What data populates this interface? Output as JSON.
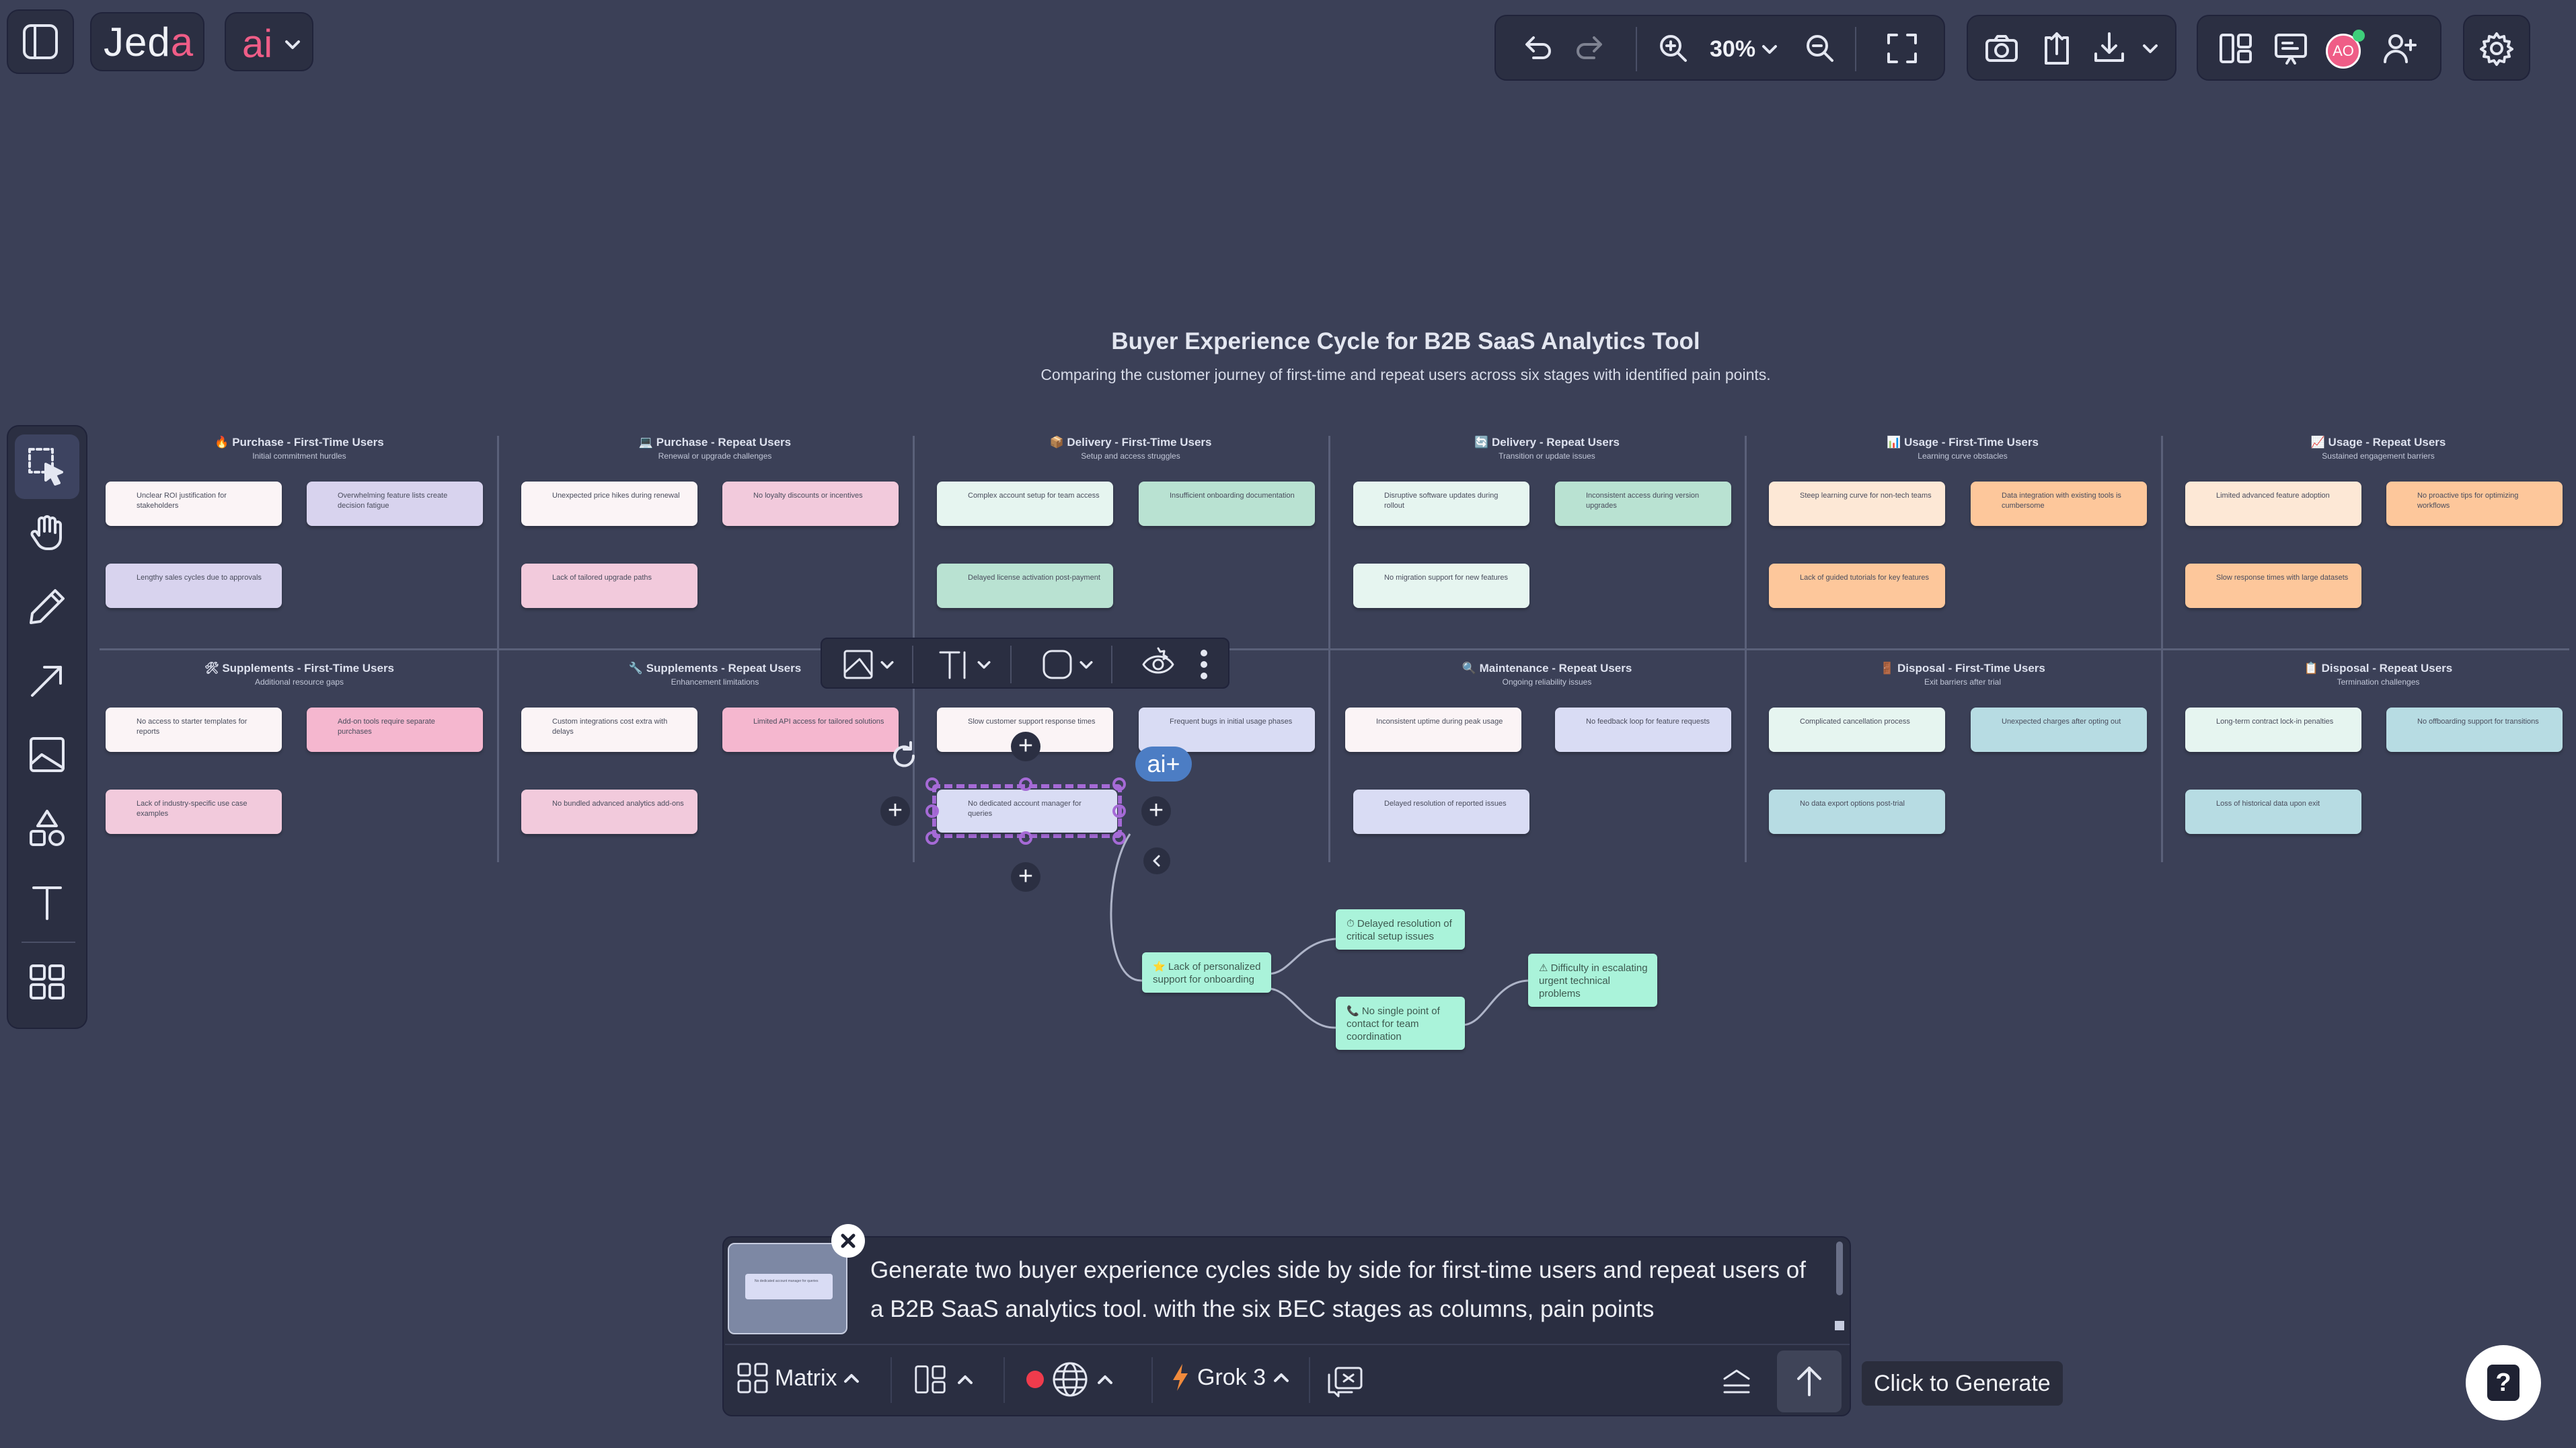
{
  "app": {
    "logo_text": "Jed",
    "logo_accent": "a",
    "ai_label": "ai",
    "accent_color": "#ef5d87"
  },
  "toolbar": {
    "zoom_value": "30%",
    "avatar_initials": "AO",
    "icons": [
      "undo-icon",
      "redo-icon",
      "zoom-in-icon",
      "zoom-out-icon",
      "fullscreen-icon",
      "camera-icon",
      "upload-icon",
      "download-icon",
      "layout-icon",
      "presentation-icon",
      "add-user-icon",
      "settings-icon"
    ]
  },
  "tools": [
    "select-tool-icon",
    "hand-tool-icon",
    "pencil-tool-icon",
    "arrow-tool-icon",
    "image-tool-icon",
    "shapes-tool-icon",
    "text-tool-icon",
    "templates-tool-icon"
  ],
  "canvas": {
    "title": "Buyer Experience Cycle for B2B SaaS Analytics Tool",
    "subtitle": "Comparing the customer journey of first-time and repeat users across six stages with identified pain points.",
    "columns_top": [
      {
        "emoji": "🔥",
        "title": "Purchase - First-Time Users",
        "sub": "Initial commitment hurdles"
      },
      {
        "emoji": "💻",
        "title": "Purchase - Repeat Users",
        "sub": "Renewal or upgrade challenges"
      },
      {
        "emoji": "📦",
        "title": "Delivery - First-Time Users",
        "sub": "Setup and access struggles"
      },
      {
        "emoji": "🔄",
        "title": "Delivery - Repeat Users",
        "sub": "Transition or update issues"
      },
      {
        "emoji": "📊",
        "title": "Usage - First-Time Users",
        "sub": "Learning curve obstacles"
      },
      {
        "emoji": "📈",
        "title": "Usage - Repeat Users",
        "sub": "Sustained engagement barriers"
      }
    ],
    "columns_bottom": [
      {
        "emoji": "🛠",
        "title": "Supplements - First-Time Users",
        "sub": "Additional resource gaps"
      },
      {
        "emoji": "🔧",
        "title": "Supplements - Repeat Users",
        "sub": "Enhancement limitations"
      },
      {
        "emoji": "",
        "title": "",
        "sub": ""
      },
      {
        "emoji": "🔍",
        "title": "Maintenance - Repeat Users",
        "sub": "Ongoing reliability issues"
      },
      {
        "emoji": "🚪",
        "title": "Disposal - First-Time Users",
        "sub": "Exit barriers after trial"
      },
      {
        "emoji": "📋",
        "title": "Disposal - Repeat Users",
        "sub": "Termination challenges"
      }
    ],
    "notes": {
      "r1": [
        [
          "Unclear ROI justification for stakeholders",
          "Overwhelming feature lists create decision fatigue",
          "Lengthy sales cycles due to approvals"
        ],
        [
          "Unexpected price hikes during renewal",
          "No loyalty discounts or incentives",
          "Lack of tailored upgrade paths"
        ],
        [
          "Complex account setup for team access",
          "Insufficient onboarding documentation",
          "Delayed license activation post-payment"
        ],
        [
          "Disruptive software updates during rollout",
          "Inconsistent access during version upgrades",
          "No migration support for new features"
        ],
        [
          "Steep learning curve for non-tech teams",
          "Data integration with existing tools is cumbersome",
          "Lack of guided tutorials for key features"
        ],
        [
          "Limited advanced feature adoption",
          "No proactive tips for optimizing workflows",
          "Slow response times with large datasets"
        ]
      ],
      "r2": [
        [
          "No access to starter templates for reports",
          "Add-on tools require separate purchases",
          "Lack of industry-specific use case examples"
        ],
        [
          "Custom integrations cost extra with delays",
          "Limited API access for tailored solutions",
          "No bundled advanced analytics add-ons"
        ],
        [
          "Slow customer support response times",
          "Frequent bugs in initial usage phases",
          "No dedicated account manager for queries"
        ],
        [
          "Inconsistent uptime during peak usage",
          "No feedback loop for feature requests",
          "Delayed resolution of reported issues"
        ],
        [
          "Complicated cancellation process",
          "Unexpected charges after opting out",
          "No data export options post-trial"
        ],
        [
          "Long-term contract lock-in penalties",
          "No offboarding support for transitions",
          "Loss of historical data upon exit"
        ]
      ]
    },
    "mindmap": {
      "root": "⭐ Lack of personalized support for onboarding",
      "child1": "⏱ Delayed resolution of critical setup issues",
      "child2": "📞 No single point of contact for team coordination",
      "grandchild": "⚠ Difficulty in escalating urgent technical problems"
    },
    "ai_plus_label": "ai+"
  },
  "prompt": {
    "text": "Generate two buyer experience cycles side by side for first-time users and repeat users of a B2B SaaS analytics tool. with the six BEC stages as columns, pain points",
    "thumbnail_text": "No dedicated account manager for queries",
    "matrix_label": "Matrix",
    "model_label": "Grok 3",
    "tooltip": "Click to Generate"
  },
  "help_label": "?"
}
